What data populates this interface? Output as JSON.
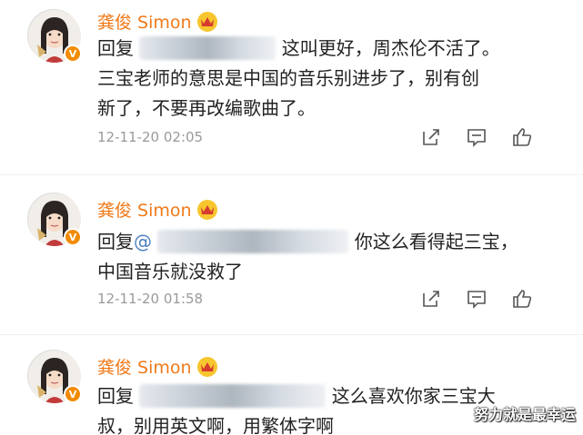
{
  "comments": [
    {
      "username": "龚俊 Simon",
      "reply_prefix": "回复",
      "mention_prefix": "",
      "line1_tail": "这叫更好，周杰伦不活了。",
      "line2": "三宝老师的意思是中国的音乐别进步了，别有创",
      "line3": "新了，不要再改编歌曲了。",
      "timestamp": "12-11-20 02:05"
    },
    {
      "username": "龚俊 Simon",
      "reply_prefix": "回复",
      "mention_prefix": "@",
      "line1_tail": "你这么看得起三宝，",
      "line2": "中国音乐就没救了",
      "line3": "",
      "timestamp": "12-11-20 01:58"
    },
    {
      "username": "龚俊 Simon",
      "reply_prefix": "回复",
      "mention_prefix": "",
      "line1_tail": "这么喜欢你家三宝大",
      "line2": "叔，别用英文啊，用繁体字啊",
      "line3": "",
      "timestamp": ""
    }
  ],
  "badges": {
    "verified": "V"
  },
  "icons": {
    "share": "share-icon",
    "comment": "comment-icon",
    "like": "thumbs-up-icon",
    "crown": "crown-icon"
  },
  "colors": {
    "username": "#f07a1a",
    "verified_badge": "#f28b00",
    "crown": "#f7c62f",
    "timestamp": "#9a9a9a"
  },
  "watermark": "努力就是最幸运"
}
